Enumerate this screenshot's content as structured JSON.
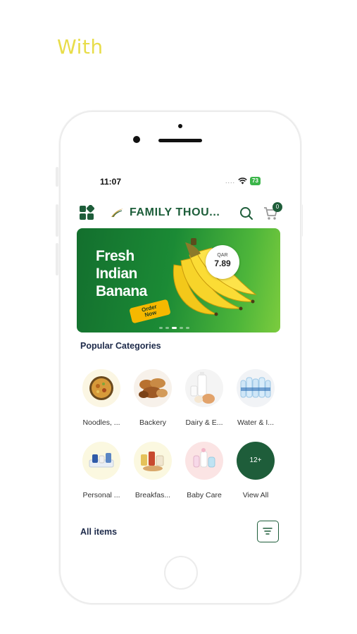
{
  "caption": "With",
  "status_bar": {
    "time": "11:07",
    "signal_dots": "....",
    "battery": "73"
  },
  "app_bar": {
    "brand": "FAMILY THOU...",
    "cart_count": "0"
  },
  "banner": {
    "title_line1": "Fresh",
    "title_line2": "Indian",
    "title_line3": "Banana",
    "currency": "QAR",
    "price": "7.89",
    "cta_line1": "Order",
    "cta_line2": "Now"
  },
  "popular": {
    "title": "Popular Categories",
    "categories": [
      {
        "label": "Noodles, ...",
        "icon": "noodles-icon"
      },
      {
        "label": "Backery",
        "icon": "bakery-icon"
      },
      {
        "label": "Dairy & E...",
        "icon": "dairy-icon"
      },
      {
        "label": "Water & I...",
        "icon": "water-icon"
      },
      {
        "label": "Personal ...",
        "icon": "personal-care-icon"
      },
      {
        "label": "Breakfas...",
        "icon": "breakfast-icon"
      },
      {
        "label": "Baby Care",
        "icon": "baby-care-icon"
      },
      {
        "label": "View All",
        "badge": "12+"
      }
    ]
  },
  "all_items": {
    "title": "All items"
  },
  "colors": {
    "brand": "#1e5d3a",
    "accent": "#f5b800",
    "caption": "#e8dd4a"
  }
}
